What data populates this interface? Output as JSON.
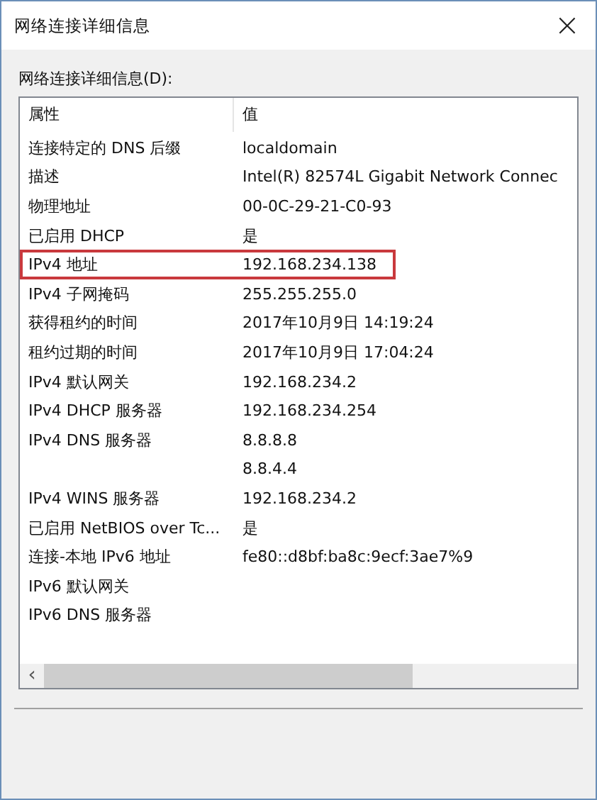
{
  "window": {
    "title": "网络连接详细信息",
    "close": "×"
  },
  "list_label": "网络连接详细信息(D):",
  "table": {
    "columns": [
      "属性",
      "值"
    ],
    "rows": [
      {
        "property": "连接特定的 DNS 后缀",
        "value": "localdomain",
        "highlighted": false
      },
      {
        "property": "描述",
        "value": "Intel(R) 82574L Gigabit Network Connec",
        "highlighted": false
      },
      {
        "property": "物理地址",
        "value": "00-0C-29-21-C0-93",
        "highlighted": false
      },
      {
        "property": "已启用 DHCP",
        "value": "是",
        "highlighted": false
      },
      {
        "property": "IPv4 地址",
        "value": "192.168.234.138",
        "highlighted": true
      },
      {
        "property": "IPv4 子网掩码",
        "value": "255.255.255.0",
        "highlighted": false
      },
      {
        "property": "获得租约的时间",
        "value": "2017年10月9日 14:19:24",
        "highlighted": false
      },
      {
        "property": "租约过期的时间",
        "value": "2017年10月9日 17:04:24",
        "highlighted": false
      },
      {
        "property": "IPv4 默认网关",
        "value": "192.168.234.2",
        "highlighted": false
      },
      {
        "property": "IPv4 DHCP 服务器",
        "value": "192.168.234.254",
        "highlighted": false
      },
      {
        "property": "IPv4 DNS 服务器",
        "value": "8.8.8.8",
        "highlighted": false
      },
      {
        "value": "8.8.4.4",
        "highlighted": false
      },
      {
        "property": "IPv4 WINS 服务器",
        "value": "192.168.234.2",
        "highlighted": false
      },
      {
        "property": "已启用 NetBIOS over Tc...",
        "value": "是",
        "highlighted": false
      },
      {
        "property": "连接-本地 IPv6 地址",
        "value": "fe80::d8bf:ba8c:9ecf:3ae7%9",
        "highlighted": false
      },
      {
        "property": "IPv6 默认网关",
        "highlighted": false
      },
      {
        "property": "IPv6 DNS 服务器",
        "highlighted": false
      }
    ]
  },
  "scrollbar": {
    "left_arrow": "‹"
  }
}
